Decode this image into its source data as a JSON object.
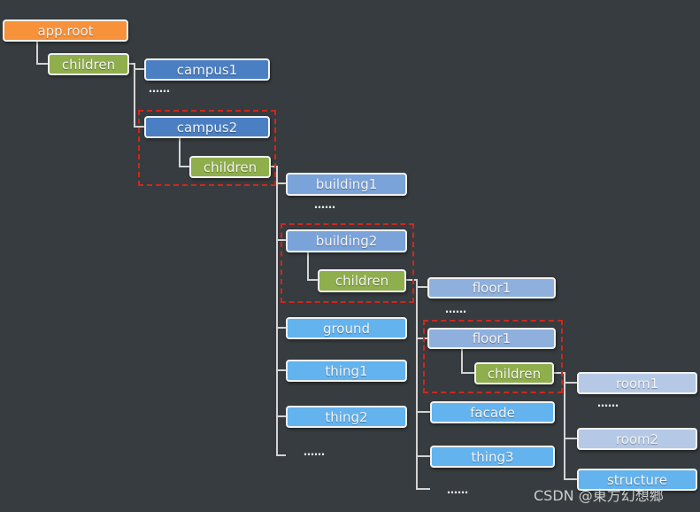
{
  "colors": {
    "root": "#f7923a",
    "children": "#8fae4c",
    "campus": "#4a7fc4",
    "building": "#7aa3da",
    "leaf": "#63b3ee",
    "floor": "#8fb0dc",
    "room": "#b5c9e6",
    "selection": "#d0271d"
  },
  "nodes": {
    "root": "app.root",
    "children1": "children",
    "campus1": "campus1",
    "campus2": "campus2",
    "children2": "children",
    "building1": "building1",
    "building2": "building2",
    "children3": "children",
    "ground": "ground",
    "thing1": "thing1",
    "thing2": "thing2",
    "floor1a": "floor1",
    "floor1b": "floor1",
    "children4": "children",
    "facade": "facade",
    "thing3": "thing3",
    "room1": "room1",
    "room2": "room2",
    "structure": "structure"
  },
  "ellipsis": "……",
  "watermark": "CSDN @東方幻想郷"
}
